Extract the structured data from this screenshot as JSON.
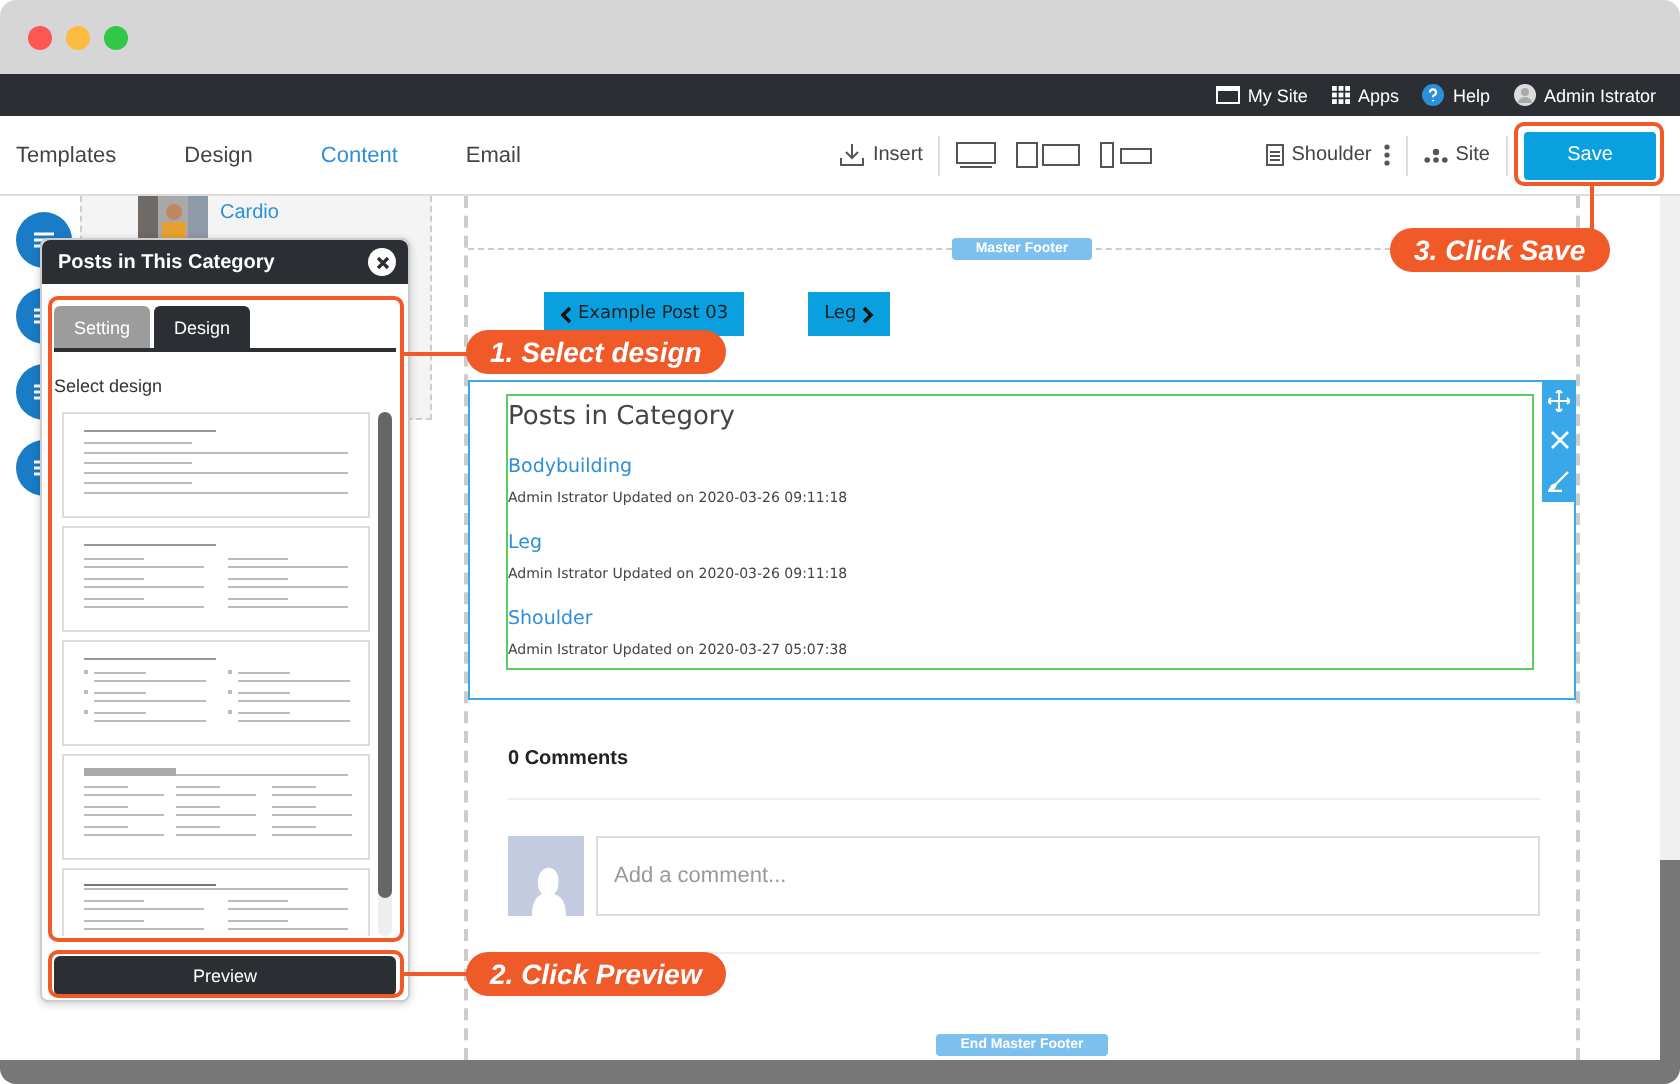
{
  "top_bar": {
    "items": [
      {
        "label": "My Site",
        "kind": "site"
      },
      {
        "label": "Apps",
        "kind": "apps"
      },
      {
        "label": "Help",
        "kind": "help"
      },
      {
        "label": "Admin Istrator",
        "kind": "user"
      }
    ]
  },
  "toolbar": {
    "tabs": [
      {
        "label": "Templates",
        "selected": false
      },
      {
        "label": "Design",
        "selected": false
      },
      {
        "label": "Content",
        "selected": true
      },
      {
        "label": "Email",
        "selected": false
      }
    ],
    "insert": "Insert",
    "page": "Shoulder",
    "site": "Site",
    "save": "Save"
  },
  "background_card": {
    "title": "Cardio"
  },
  "panel": {
    "title": "Posts in This Category",
    "tabs": [
      {
        "label": "Setting",
        "selected": false
      },
      {
        "label": "Design",
        "selected": true
      }
    ],
    "section_label": "Select design",
    "designs": [
      {
        "kind": "single"
      },
      {
        "kind": "double"
      },
      {
        "kind": "numbered"
      },
      {
        "kind": "triple"
      },
      {
        "kind": "heading"
      }
    ],
    "preview": "Preview"
  },
  "page": {
    "header_marker": "Master Footer",
    "nav": [
      {
        "label": "Example Post 03",
        "kind": "prev"
      },
      {
        "label": "Leg",
        "kind": "next"
      }
    ],
    "widget": {
      "title": "Posts in Category",
      "posts": [
        {
          "title": "Bodybuilding",
          "meta": "Admin Istrator Updated on 2020-03-26 09:11:18"
        },
        {
          "title": "Leg",
          "meta": "Admin Istrator Updated on 2020-03-26 09:11:18"
        },
        {
          "title": "Shoulder",
          "meta": "Admin Istrator Updated on 2020-03-27 05:07:38"
        }
      ]
    },
    "comments": {
      "count": "0 Comments",
      "placeholder": "Add a comment..."
    },
    "footer_marker": "End Master Footer"
  },
  "annotations": [
    {
      "label": "1. Select design"
    },
    {
      "label": "2. Click Preview"
    },
    {
      "label": "3. Click Save"
    }
  ]
}
